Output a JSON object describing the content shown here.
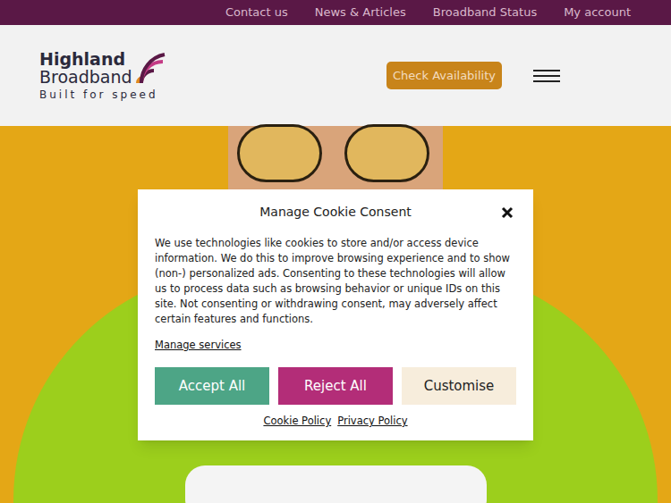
{
  "top_nav": {
    "links": [
      "Contact us",
      "News & Articles",
      "Broadband Status",
      "My account"
    ]
  },
  "header": {
    "logo": {
      "line1": "Highland",
      "line2": "Broadband",
      "tagline": "Built for speed"
    },
    "cta": "Check Availability"
  },
  "cookie_dialog": {
    "title": "Manage Cookie Consent",
    "body": "We use technologies like cookies to store and/or access device information. We do this to improve browsing experience and to show (non-) personalized ads. Consenting to these technologies will allow us to process data such as browsing behavior or unique IDs on this site. Not consenting or withdrawing consent, may adversely affect certain features and functions.",
    "manage_link": "Manage services",
    "buttons": [
      {
        "label": "Accept All",
        "color": "#4da586"
      },
      {
        "label": "Reject All",
        "color": "#b32d78"
      },
      {
        "label": "Customise",
        "color": "#f7eddc"
      }
    ],
    "footer_links": [
      "Cookie Policy",
      "Privacy Policy"
    ]
  }
}
